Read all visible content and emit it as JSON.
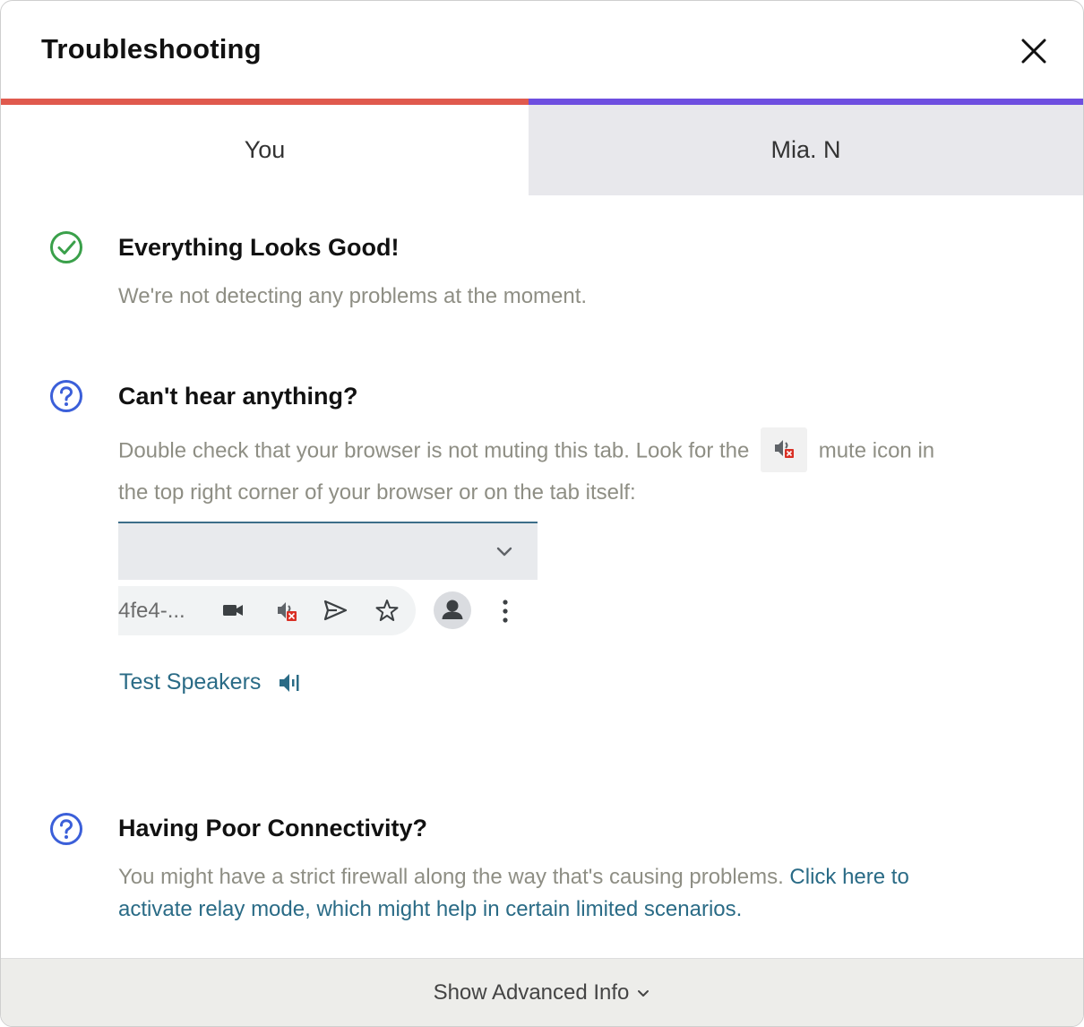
{
  "dialog": {
    "title": "Troubleshooting",
    "close_icon": "close-icon"
  },
  "tabs": [
    {
      "label": "You",
      "accent": "#e05a4e",
      "selected": true
    },
    {
      "label": "Mia. N",
      "accent": "#6e4ee0",
      "selected": false
    }
  ],
  "sections": {
    "status": {
      "icon": "check-circle-icon",
      "icon_color": "#3aa04a",
      "title": "Everything Looks Good!",
      "text": "We're not detecting any problems at the moment."
    },
    "audio": {
      "icon": "question-circle-icon",
      "icon_color": "#3b5fd9",
      "title": "Can't hear anything?",
      "text_before": "Double check that your browser is not muting this tab. Look for the",
      "text_after": "mute icon in",
      "text_line2": "the top right corner of your browser or on the tab itself:",
      "browser_url": "4fe4-...",
      "test_speakers_label": "Test Speakers"
    },
    "connectivity": {
      "icon": "question-circle-icon",
      "icon_color": "#3b5fd9",
      "title": "Having Poor Connectivity?",
      "text": "You might have a strict firewall along the way that's causing problems.",
      "link_line1": "Click here to",
      "link_line2": "activate relay mode, which might help in certain limited scenarios."
    }
  },
  "footer": {
    "label": "Show Advanced Info"
  },
  "colors": {
    "link": "#2a6b86",
    "muted_text": "#8e8e84"
  }
}
